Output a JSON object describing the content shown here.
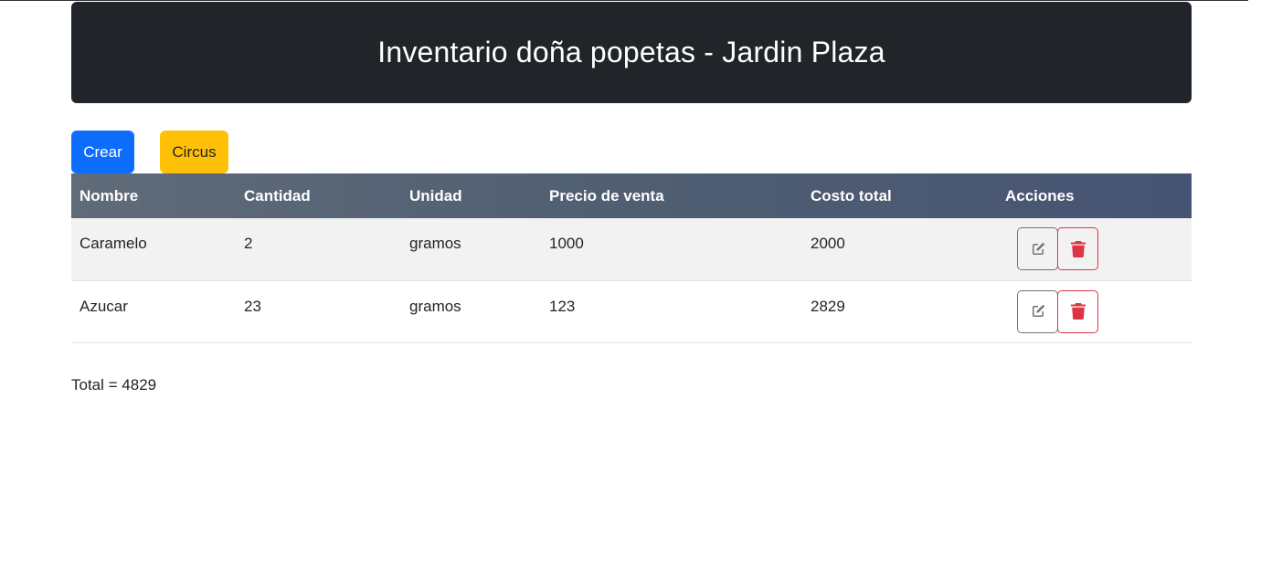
{
  "header": {
    "title": "Inventario doña popetas - Jardin Plaza"
  },
  "toolbar": {
    "create_label": "Crear",
    "circus_label": "Circus"
  },
  "table": {
    "columns": [
      "Nombre",
      "Cantidad",
      "Unidad",
      "Precio de venta",
      "Costo total",
      "Acciones"
    ],
    "rows": [
      {
        "nombre": "Caramelo",
        "cantidad": "2",
        "unidad": "gramos",
        "precio": "1000",
        "costo": "2000"
      },
      {
        "nombre": "Azucar",
        "cantidad": "23",
        "unidad": "gramos",
        "precio": "123",
        "costo": "2829"
      }
    ]
  },
  "footer": {
    "total": "Total = 4829"
  },
  "colors": {
    "header_bg": "#212529",
    "create_button": "#0d6efd",
    "circus_button": "#ffc107",
    "edit_outline": "#6c757d",
    "delete_outline": "#dc3545"
  },
  "icons": {
    "edit": "pen-to-square-icon",
    "delete": "trash-icon"
  }
}
